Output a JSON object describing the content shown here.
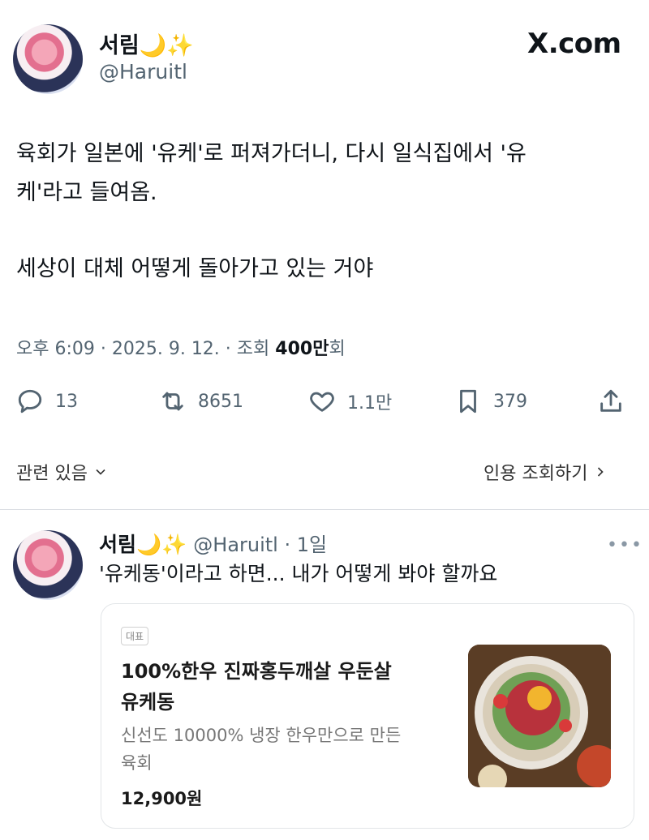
{
  "tweet": {
    "display_name": "서림🌙✨",
    "handle": "@Haruitl",
    "site_logo": "X.com",
    "text_line1": "육회가 일본에 '유케'로 퍼져가더니, 다시 일식집에서 '유",
    "text_line2": "케'라고 들여옴.",
    "text_line3": "세상이 대체 어떻게 돌아가고 있는 거야",
    "meta_prefix": "오후 6:09 · 2025. 9. 12. · 조회 ",
    "views": "400만",
    "views_suffix": "회",
    "actions": {
      "replies": "13",
      "retweets": "8651",
      "likes": "1.1만",
      "bookmarks": "379"
    },
    "related_label": "관련 있음",
    "quotes_label": "인용 조회하기"
  },
  "reply": {
    "display_name": "서림🌙✨",
    "handle_time": "@Haruitl · 1일",
    "text": "'유케동'이라고 하면... 내가 어떻게 봐야 할까요",
    "card": {
      "badge": "대표",
      "title_line1": "100%한우 진짜홍두깨살 우둔살",
      "title_line2": "유케동",
      "desc_line1": "신선도 10000% 냉장 한우만으로 만든",
      "desc_line2": "육회",
      "price": "12,900원"
    }
  },
  "icons": [
    "reply-icon",
    "retweet-icon",
    "like-icon",
    "bookmark-icon",
    "share-icon",
    "chevron-down-icon",
    "chevron-right-icon",
    "more-icon"
  ]
}
